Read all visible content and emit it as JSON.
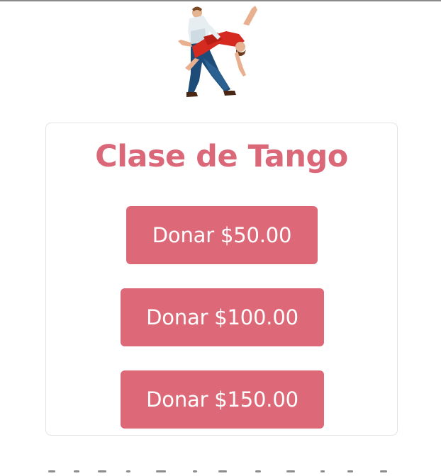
{
  "page": {
    "title": "Clase de Tango"
  },
  "donations": [
    {
      "label": "Donar $50.00"
    },
    {
      "label": "Donar $100.00"
    },
    {
      "label": "Donar $150.00"
    }
  ],
  "colors": {
    "accent": "#dd6878",
    "card_border": "#e3e3e3",
    "button_text": "#ffffff"
  },
  "icons": {
    "header_image": "tango-dancers-illustration"
  }
}
